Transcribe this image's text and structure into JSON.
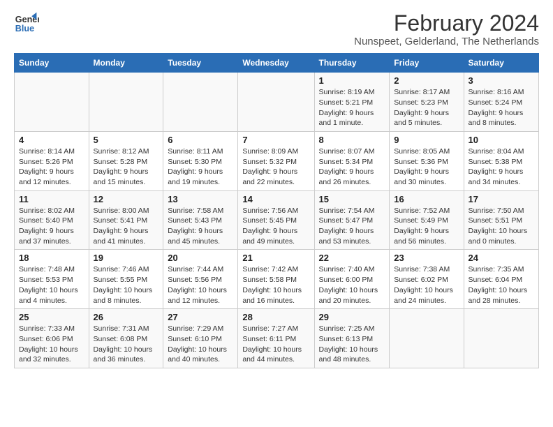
{
  "logo": {
    "line1": "General",
    "line2": "Blue"
  },
  "title": "February 2024",
  "subtitle": "Nunspeet, Gelderland, The Netherlands",
  "headers": [
    "Sunday",
    "Monday",
    "Tuesday",
    "Wednesday",
    "Thursday",
    "Friday",
    "Saturday"
  ],
  "weeks": [
    [
      {
        "day": "",
        "info": ""
      },
      {
        "day": "",
        "info": ""
      },
      {
        "day": "",
        "info": ""
      },
      {
        "day": "",
        "info": ""
      },
      {
        "day": "1",
        "info": "Sunrise: 8:19 AM\nSunset: 5:21 PM\nDaylight: 9 hours and 1 minute."
      },
      {
        "day": "2",
        "info": "Sunrise: 8:17 AM\nSunset: 5:23 PM\nDaylight: 9 hours and 5 minutes."
      },
      {
        "day": "3",
        "info": "Sunrise: 8:16 AM\nSunset: 5:24 PM\nDaylight: 9 hours and 8 minutes."
      }
    ],
    [
      {
        "day": "4",
        "info": "Sunrise: 8:14 AM\nSunset: 5:26 PM\nDaylight: 9 hours and 12 minutes."
      },
      {
        "day": "5",
        "info": "Sunrise: 8:12 AM\nSunset: 5:28 PM\nDaylight: 9 hours and 15 minutes."
      },
      {
        "day": "6",
        "info": "Sunrise: 8:11 AM\nSunset: 5:30 PM\nDaylight: 9 hours and 19 minutes."
      },
      {
        "day": "7",
        "info": "Sunrise: 8:09 AM\nSunset: 5:32 PM\nDaylight: 9 hours and 22 minutes."
      },
      {
        "day": "8",
        "info": "Sunrise: 8:07 AM\nSunset: 5:34 PM\nDaylight: 9 hours and 26 minutes."
      },
      {
        "day": "9",
        "info": "Sunrise: 8:05 AM\nSunset: 5:36 PM\nDaylight: 9 hours and 30 minutes."
      },
      {
        "day": "10",
        "info": "Sunrise: 8:04 AM\nSunset: 5:38 PM\nDaylight: 9 hours and 34 minutes."
      }
    ],
    [
      {
        "day": "11",
        "info": "Sunrise: 8:02 AM\nSunset: 5:40 PM\nDaylight: 9 hours and 37 minutes."
      },
      {
        "day": "12",
        "info": "Sunrise: 8:00 AM\nSunset: 5:41 PM\nDaylight: 9 hours and 41 minutes."
      },
      {
        "day": "13",
        "info": "Sunrise: 7:58 AM\nSunset: 5:43 PM\nDaylight: 9 hours and 45 minutes."
      },
      {
        "day": "14",
        "info": "Sunrise: 7:56 AM\nSunset: 5:45 PM\nDaylight: 9 hours and 49 minutes."
      },
      {
        "day": "15",
        "info": "Sunrise: 7:54 AM\nSunset: 5:47 PM\nDaylight: 9 hours and 53 minutes."
      },
      {
        "day": "16",
        "info": "Sunrise: 7:52 AM\nSunset: 5:49 PM\nDaylight: 9 hours and 56 minutes."
      },
      {
        "day": "17",
        "info": "Sunrise: 7:50 AM\nSunset: 5:51 PM\nDaylight: 10 hours and 0 minutes."
      }
    ],
    [
      {
        "day": "18",
        "info": "Sunrise: 7:48 AM\nSunset: 5:53 PM\nDaylight: 10 hours and 4 minutes."
      },
      {
        "day": "19",
        "info": "Sunrise: 7:46 AM\nSunset: 5:55 PM\nDaylight: 10 hours and 8 minutes."
      },
      {
        "day": "20",
        "info": "Sunrise: 7:44 AM\nSunset: 5:56 PM\nDaylight: 10 hours and 12 minutes."
      },
      {
        "day": "21",
        "info": "Sunrise: 7:42 AM\nSunset: 5:58 PM\nDaylight: 10 hours and 16 minutes."
      },
      {
        "day": "22",
        "info": "Sunrise: 7:40 AM\nSunset: 6:00 PM\nDaylight: 10 hours and 20 minutes."
      },
      {
        "day": "23",
        "info": "Sunrise: 7:38 AM\nSunset: 6:02 PM\nDaylight: 10 hours and 24 minutes."
      },
      {
        "day": "24",
        "info": "Sunrise: 7:35 AM\nSunset: 6:04 PM\nDaylight: 10 hours and 28 minutes."
      }
    ],
    [
      {
        "day": "25",
        "info": "Sunrise: 7:33 AM\nSunset: 6:06 PM\nDaylight: 10 hours and 32 minutes."
      },
      {
        "day": "26",
        "info": "Sunrise: 7:31 AM\nSunset: 6:08 PM\nDaylight: 10 hours and 36 minutes."
      },
      {
        "day": "27",
        "info": "Sunrise: 7:29 AM\nSunset: 6:10 PM\nDaylight: 10 hours and 40 minutes."
      },
      {
        "day": "28",
        "info": "Sunrise: 7:27 AM\nSunset: 6:11 PM\nDaylight: 10 hours and 44 minutes."
      },
      {
        "day": "29",
        "info": "Sunrise: 7:25 AM\nSunset: 6:13 PM\nDaylight: 10 hours and 48 minutes."
      },
      {
        "day": "",
        "info": ""
      },
      {
        "day": "",
        "info": ""
      }
    ]
  ]
}
